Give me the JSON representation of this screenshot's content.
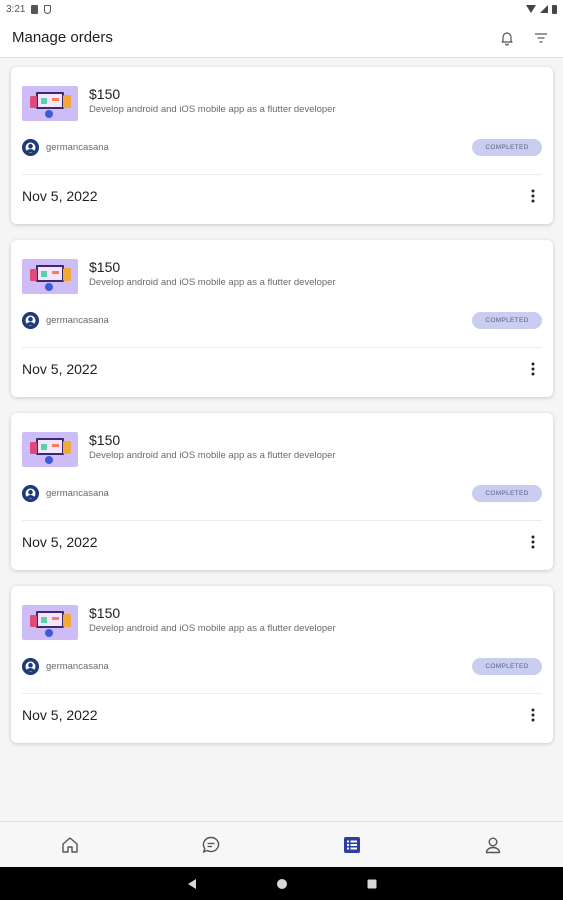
{
  "status_bar": {
    "time": "3:21"
  },
  "app_bar": {
    "title": "Manage orders"
  },
  "orders": [
    {
      "price": "$150",
      "description": "Develop android and iOS mobile app as a flutter developer",
      "seller": "germancasana",
      "status": "COMPLETED",
      "date": "Nov 5, 2022"
    },
    {
      "price": "$150",
      "description": "Develop android and iOS mobile app as a flutter developer",
      "seller": "germancasana",
      "status": "COMPLETED",
      "date": "Nov 5, 2022"
    },
    {
      "price": "$150",
      "description": "Develop android and iOS mobile app as a flutter developer",
      "seller": "germancasana",
      "status": "COMPLETED",
      "date": "Nov 5, 2022"
    },
    {
      "price": "$150",
      "description": "Develop android and iOS mobile app as a flutter developer",
      "seller": "germancasana",
      "status": "COMPLETED",
      "date": "Nov 5, 2022"
    }
  ],
  "bottom_nav": {
    "items": [
      {
        "icon": "home-icon",
        "active": false
      },
      {
        "icon": "chat-icon",
        "active": false
      },
      {
        "icon": "orders-list-icon",
        "active": true
      },
      {
        "icon": "profile-icon",
        "active": false
      }
    ]
  },
  "colors": {
    "accent": "#2a3fa0",
    "badge_bg": "#c9cdf0",
    "thumb_bg": "#cdbcf5",
    "nav_inactive": "#555555"
  }
}
